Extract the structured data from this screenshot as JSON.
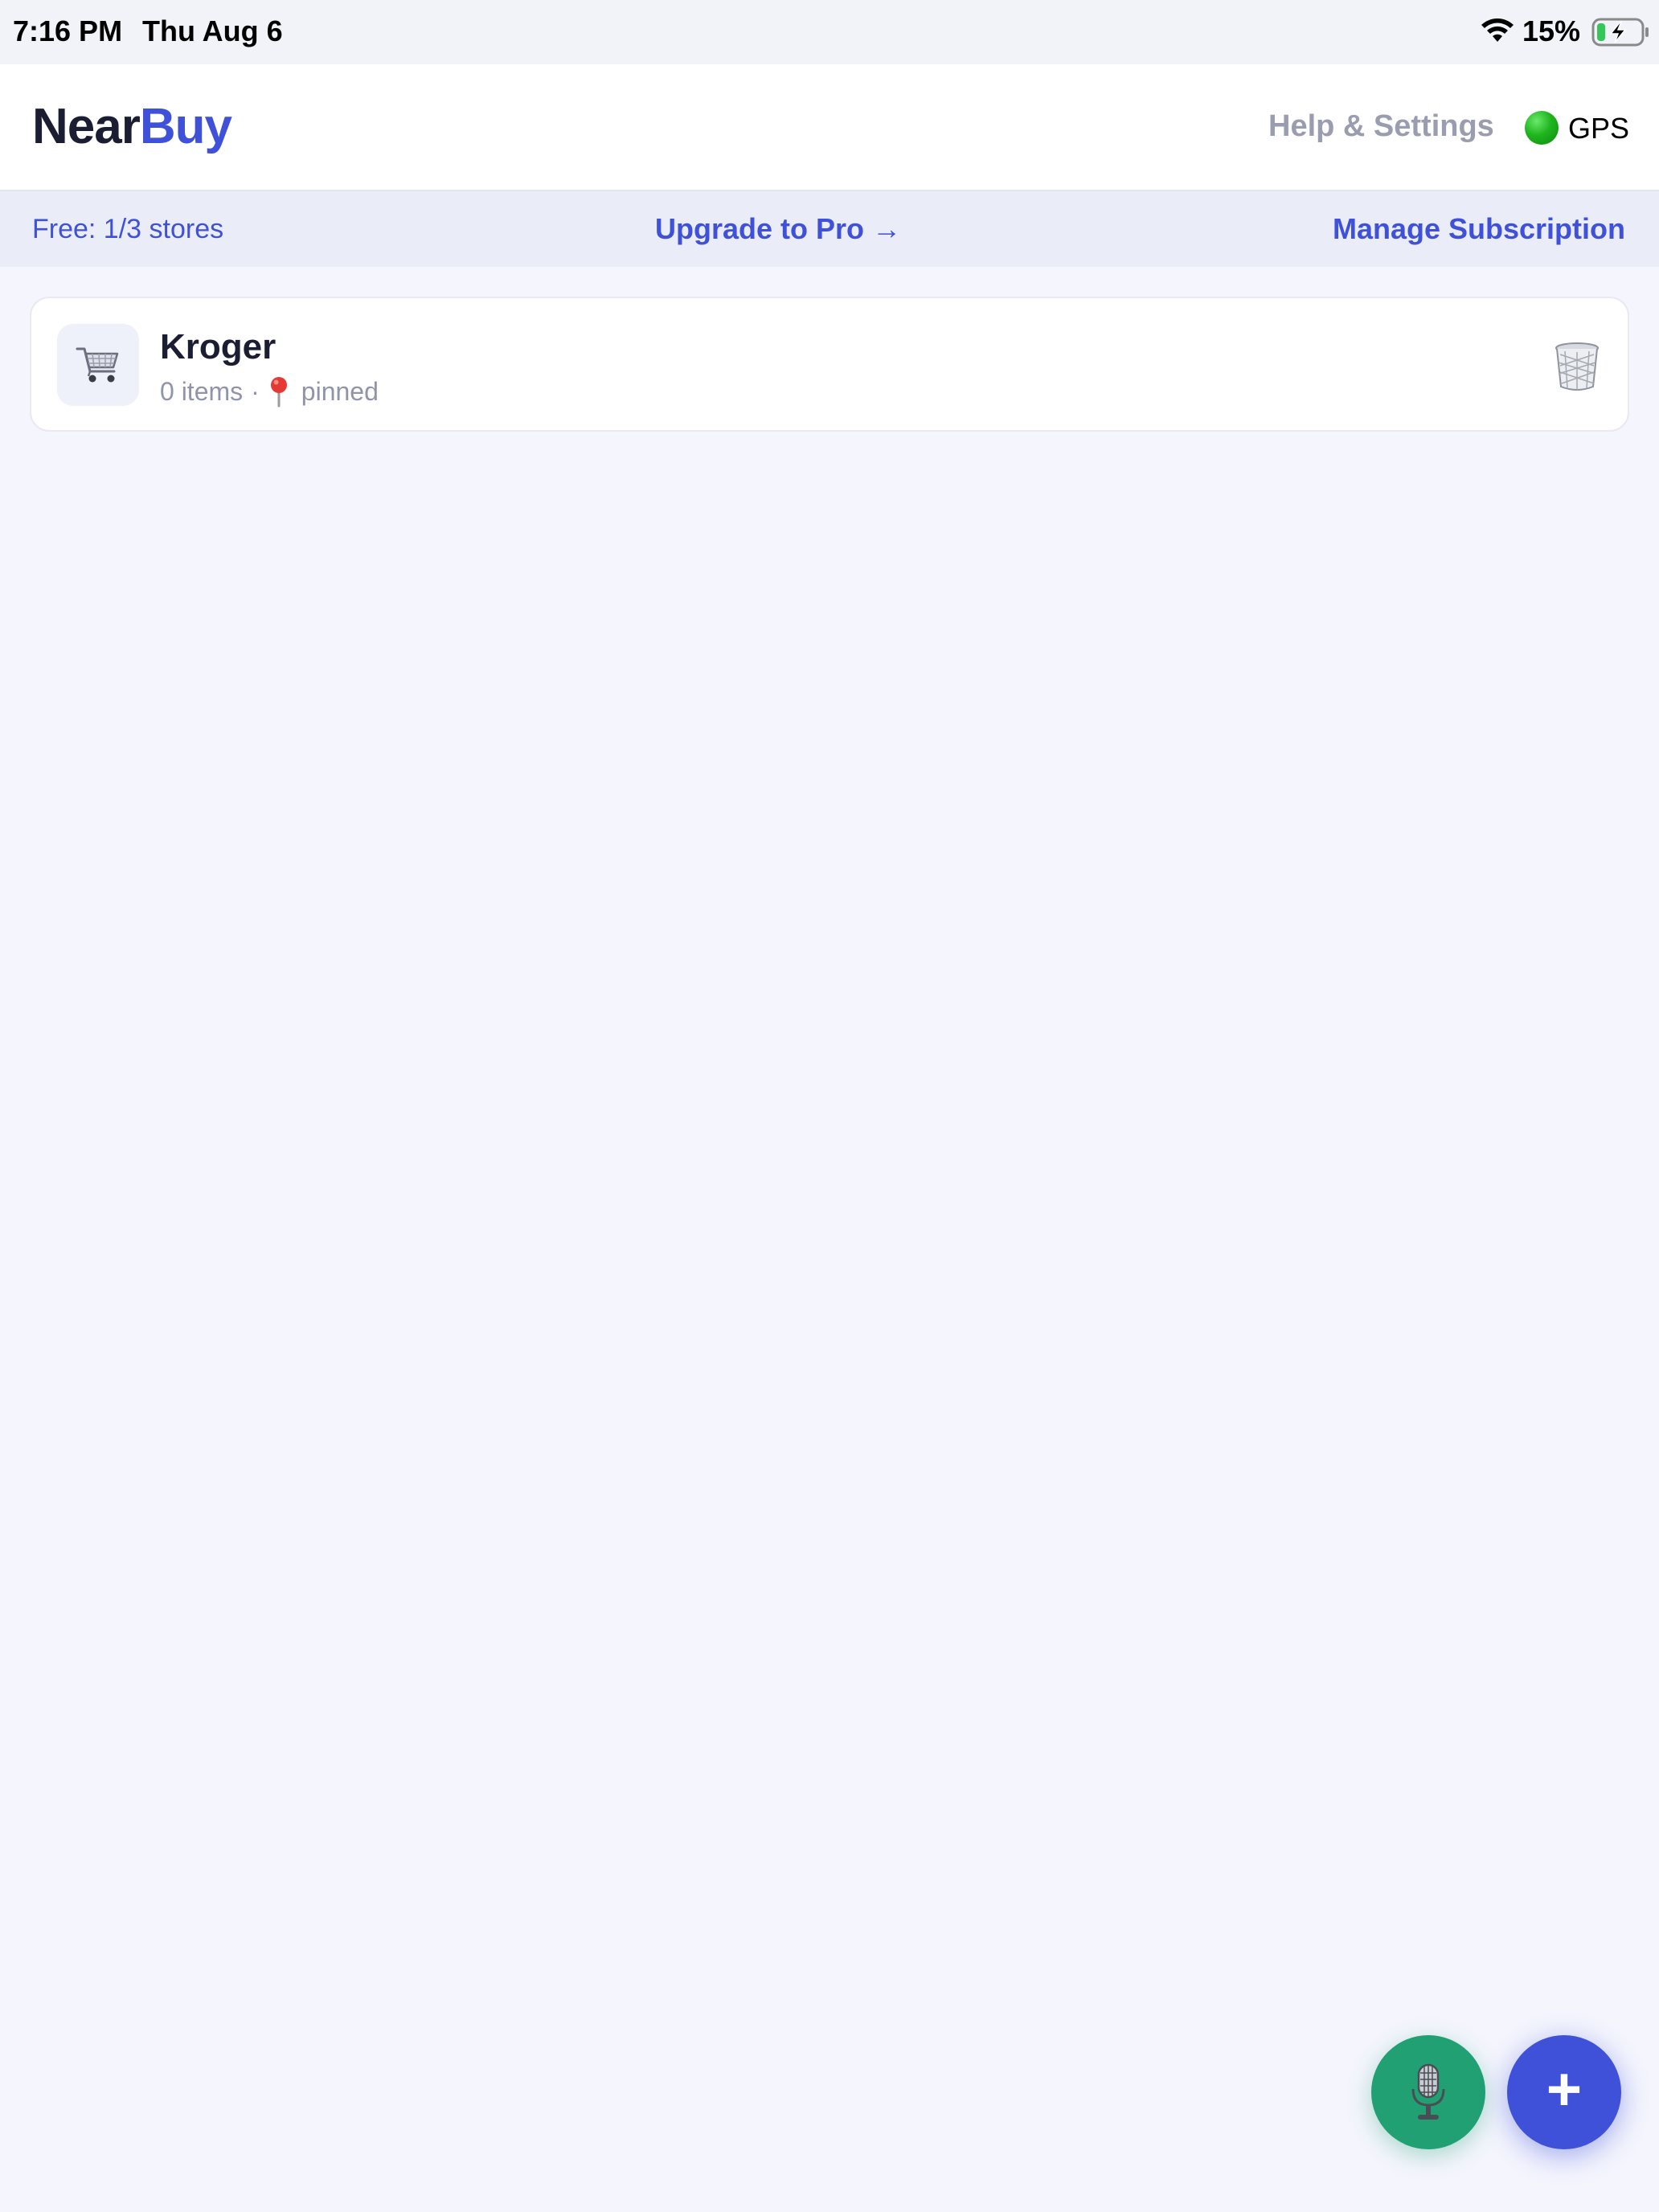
{
  "status_bar": {
    "time": "7:16 PM",
    "date": "Thu Aug 6",
    "battery_percent": "15%",
    "icons": [
      "wifi-icon",
      "battery-charging-icon"
    ]
  },
  "header": {
    "brand_part1": "Near",
    "brand_part2": "Buy",
    "help_label": "Help & Settings",
    "gps_label": "GPS",
    "gps_status_color": "#1fb51f"
  },
  "subscription": {
    "plan_text": "Free: 1/3 stores",
    "upgrade_label": "Upgrade to Pro →",
    "manage_label": "Manage Subscription"
  },
  "stores": [
    {
      "name": "Kroger",
      "items_text": "0 items",
      "separator": "·",
      "status_text": "pinned",
      "icon": "shopping-cart-icon"
    }
  ],
  "fabs": {
    "voice_icon": "microphone-icon",
    "add_label": "+"
  },
  "colors": {
    "accent": "#3f51d9",
    "voice_button": "#21a074",
    "background": "#f4f5fd"
  }
}
